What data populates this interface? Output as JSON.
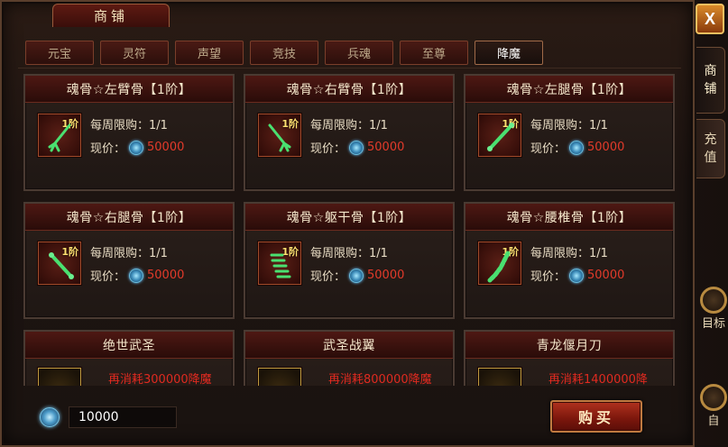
{
  "window": {
    "title": "商铺",
    "close_label": "X"
  },
  "side_tabs": [
    {
      "label_1": "商",
      "label_2": "铺"
    },
    {
      "label_1": "充",
      "label_2": "值"
    }
  ],
  "side_icons": [
    {
      "label": "目标"
    },
    {
      "label": "自"
    }
  ],
  "categories": [
    "元宝",
    "灵符",
    "声望",
    "竞技",
    "兵魂",
    "至尊",
    "降魔"
  ],
  "active_category": "降魔",
  "items": [
    {
      "name": "魂骨☆左臂骨【1阶】",
      "tier": "1阶",
      "limit": "每周限购：1/1",
      "price_label": "现价：",
      "price": "50000"
    },
    {
      "name": "魂骨☆右臂骨【1阶】",
      "tier": "1阶",
      "limit": "每周限购：1/1",
      "price_label": "现价：",
      "price": "50000"
    },
    {
      "name": "魂骨☆左腿骨【1阶】",
      "tier": "1阶",
      "limit": "每周限购：1/1",
      "price_label": "现价：",
      "price": "50000"
    },
    {
      "name": "魂骨☆右腿骨【1阶】",
      "tier": "1阶",
      "limit": "每周限购：1/1",
      "price_label": "现价：",
      "price": "50000"
    },
    {
      "name": "魂骨☆躯干骨【1阶】",
      "tier": "1阶",
      "limit": "每周限购：1/1",
      "price_label": "现价：",
      "price": "50000"
    },
    {
      "name": "魂骨☆腰椎骨【1阶】",
      "tier": "1阶",
      "limit": "每周限购：1/1",
      "price_label": "现价：",
      "price": "50000"
    },
    {
      "name": "绝世武圣",
      "requirement": "再消耗300000降魔"
    },
    {
      "name": "武圣战翼",
      "requirement": "再消耗800000降魔"
    },
    {
      "name": "青龙偃月刀",
      "requirement": "再消耗1400000降"
    }
  ],
  "wallet": {
    "amount": "10000"
  },
  "buy_button": "购买",
  "colors": {
    "price": "#e23a2a",
    "accent": "#b0321e",
    "tier": "#ffe070",
    "item_glow": "#4ae070"
  }
}
